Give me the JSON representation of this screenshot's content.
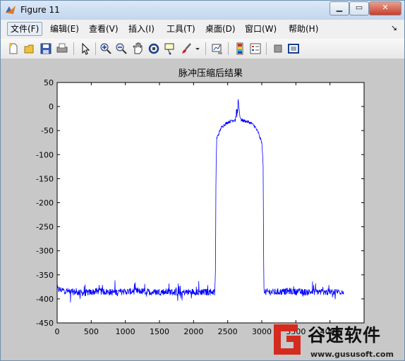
{
  "window": {
    "title": "Figure 11"
  },
  "menubar": {
    "items": [
      "文件(F)",
      "编辑(E)",
      "查看(V)",
      "插入(I)",
      "工具(T)",
      "桌面(D)",
      "窗口(W)",
      "帮助(H)"
    ],
    "overflow_arrow": "↘"
  },
  "toolbar": {
    "buttons": [
      "new-figure",
      "open-file",
      "save-figure",
      "print-figure",
      "edit-plot",
      "zoom-in",
      "zoom-out",
      "pan",
      "rotate-3d",
      "data-cursor",
      "brush",
      "link-plot",
      "insert-colorbar",
      "insert-legend",
      "hide-plot-tools",
      "show-plot-tools"
    ]
  },
  "colors": {
    "line": "#0000ff",
    "figure_bg": "#c8c8c8",
    "axes_bg": "#ffffff"
  },
  "chart_data": {
    "type": "line",
    "title": "脉冲压缩后结果",
    "xlabel": "",
    "ylabel": "",
    "xlim": [
      0,
      4500
    ],
    "ylim": [
      -450,
      50
    ],
    "xticks": [
      0,
      500,
      1000,
      1500,
      2000,
      2500,
      3000,
      3500,
      4000
    ],
    "yticks": [
      50,
      0,
      -50,
      -100,
      -150,
      -200,
      -250,
      -300,
      -350,
      -400,
      -450
    ],
    "grid": false,
    "series": [
      {
        "color": "#0000ff",
        "description_points": [
          [
            0,
            -380
          ],
          [
            200,
            -385
          ],
          [
            400,
            -388
          ],
          [
            600,
            -384
          ],
          [
            800,
            -386
          ],
          [
            1000,
            -385
          ],
          [
            1200,
            -384
          ],
          [
            1400,
            -386
          ],
          [
            1600,
            -385
          ],
          [
            1800,
            -387
          ],
          [
            2000,
            -385
          ],
          [
            2200,
            -386
          ],
          [
            2310,
            -385
          ],
          [
            2320,
            -340
          ],
          [
            2330,
            -130
          ],
          [
            2340,
            -65
          ],
          [
            2360,
            -60
          ],
          [
            2400,
            -45
          ],
          [
            2450,
            -38
          ],
          [
            2500,
            -33
          ],
          [
            2550,
            -30
          ],
          [
            2600,
            -28
          ],
          [
            2640,
            -20
          ],
          [
            2660,
            5
          ],
          [
            2680,
            -20
          ],
          [
            2700,
            -28
          ],
          [
            2750,
            -30
          ],
          [
            2800,
            -32
          ],
          [
            2850,
            -35
          ],
          [
            2900,
            -42
          ],
          [
            2950,
            -55
          ],
          [
            3000,
            -75
          ],
          [
            3020,
            -120
          ],
          [
            3030,
            -380
          ],
          [
            3040,
            -385
          ],
          [
            3200,
            -386
          ],
          [
            3400,
            -384
          ],
          [
            3600,
            -386
          ],
          [
            3800,
            -385
          ],
          [
            4000,
            -386
          ],
          [
            4200,
            -384
          ]
        ]
      }
    ]
  },
  "watermark": {
    "brand": "谷速软件",
    "site": "www.gususoft.com"
  }
}
